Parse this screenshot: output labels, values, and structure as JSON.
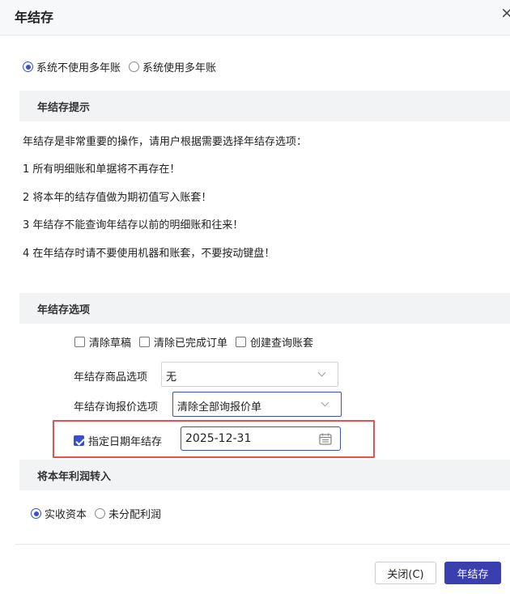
{
  "dialog": {
    "title": "年结存",
    "close_glyph": "×"
  },
  "account_mode": {
    "options": [
      {
        "label": "系统不使用多年账",
        "selected": true
      },
      {
        "label": "系统使用多年账",
        "selected": false
      }
    ]
  },
  "notice": {
    "title": "年结存提示",
    "lines": [
      "年结存是非常重要的操作，请用户根据需要选择年结存选项：",
      "1 所有明细账和单据将不再存在！",
      "2 将本年的结存值做为期初值写入账套！",
      "3 年结存不能查询年结存以前的明细账和往来！",
      "4 在年结存时请不要使用机器和账套，不要按动键盘！"
    ]
  },
  "options": {
    "title": "年结存选项",
    "checkboxes": [
      {
        "label": "清除草稿",
        "checked": false
      },
      {
        "label": "清除已完成订单",
        "checked": false
      },
      {
        "label": "创建查询账套",
        "checked": false
      }
    ],
    "goods_option": {
      "label": "年结存商品选项",
      "value": "无"
    },
    "inquiry_option": {
      "label": "年结存询报价选项",
      "value": "清除全部询报价单"
    },
    "specified_date": {
      "label": "指定日期年结存",
      "checked": true,
      "value": "2025-12-31"
    }
  },
  "profit": {
    "title": "将本年利润转入",
    "options": [
      {
        "label": "实收资本",
        "selected": true
      },
      {
        "label": "未分配利润",
        "selected": false
      }
    ]
  },
  "buttons": {
    "close": "关闭(C)",
    "confirm": "年结存"
  },
  "colors": {
    "accent": "#3a50c8",
    "primary_button": "#3a3fb0",
    "highlight": "#e85050"
  }
}
